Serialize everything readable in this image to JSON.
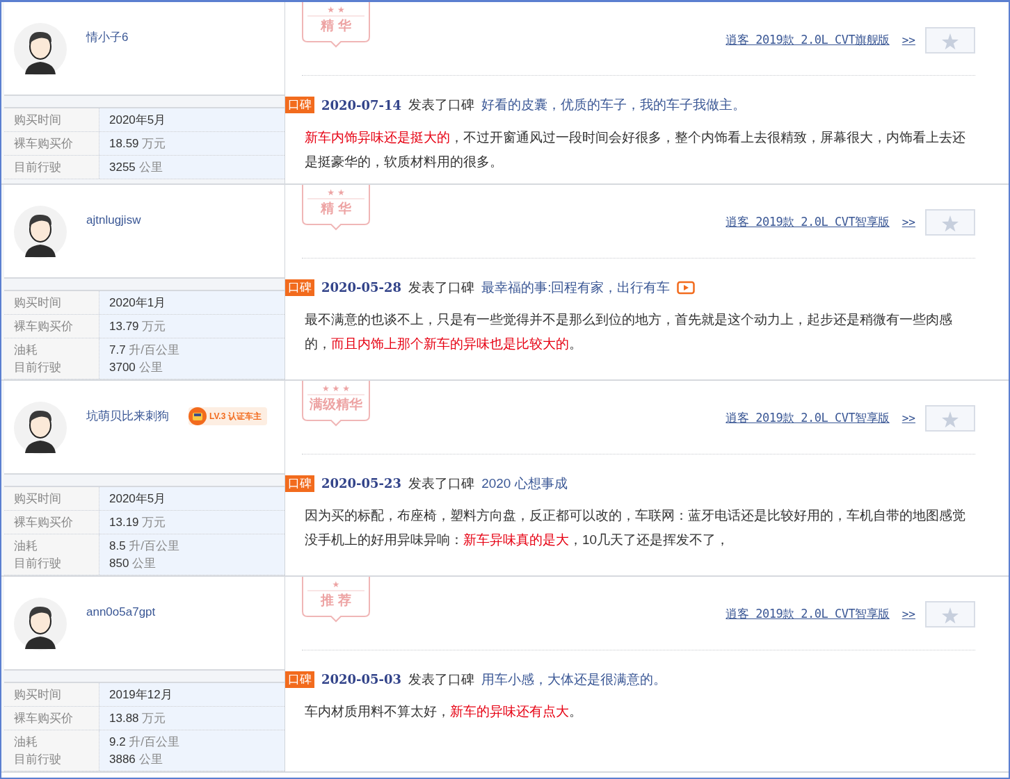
{
  "reviews": [
    {
      "user": {
        "name": "情小子6"
      },
      "specs": [
        {
          "labels": [
            "购买时间"
          ],
          "values": [
            {
              "num": "2020年5月"
            }
          ]
        },
        {
          "labels": [
            "裸车购买价"
          ],
          "values": [
            {
              "num": "18.59",
              "unit": "万元"
            }
          ]
        },
        {
          "labels": [
            "目前行驶"
          ],
          "values": [
            {
              "num": "3255",
              "unit": "公里"
            }
          ]
        }
      ],
      "stamp": {
        "ornament": "★ ★",
        "label": "精 华"
      },
      "model": "逍客 2019款 2.0L CVT旗舰版",
      "more": ">>",
      "tag": "口碑",
      "date": "2020-07-14",
      "action": "发表了口碑",
      "title": "好看的皮囊，优质的车子，我的车子我做主。",
      "video": false,
      "body": [
        {
          "text": "新车内饰异味还是挺大的",
          "highlight": true
        },
        {
          "text": "，不过开窗通风过一段时间会好很多，整个内饰看上去很精致，屏幕很大，内饰看上去还是挺豪华的，软质材料用的很多。",
          "highlight": false
        }
      ]
    },
    {
      "user": {
        "name": "ajtnlugjisw"
      },
      "specs": [
        {
          "labels": [
            "购买时间"
          ],
          "values": [
            {
              "num": "2020年1月"
            }
          ]
        },
        {
          "labels": [
            "裸车购买价"
          ],
          "values": [
            {
              "num": "13.79",
              "unit": "万元"
            }
          ]
        },
        {
          "labels": [
            "油耗",
            "目前行驶"
          ],
          "values": [
            {
              "num": "7.7",
              "unit": "升/百公里"
            },
            {
              "num": "3700",
              "unit": "公里"
            }
          ]
        }
      ],
      "stamp": {
        "ornament": "★ ★",
        "label": "精 华"
      },
      "model": "逍客 2019款 2.0L CVT智享版",
      "more": ">>",
      "tag": "口碑",
      "date": "2020-05-28",
      "action": "发表了口碑",
      "title": "最幸福的事:回程有家，出行有车",
      "video": true,
      "body": [
        {
          "text": "最不满意的也谈不上，只是有一些觉得并不是那么到位的地方，首先就是这个动力上，起步还是稍微有一些肉感的，",
          "highlight": false
        },
        {
          "text": "而且内饰上那个新车的异味也是比较大的",
          "highlight": true
        },
        {
          "text": "。",
          "highlight": false
        }
      ]
    },
    {
      "user": {
        "name": "坑萌贝比来刺狗",
        "certified": {
          "level": "LV.3",
          "label": "认证车主"
        }
      },
      "specs": [
        {
          "labels": [
            "购买时间"
          ],
          "values": [
            {
              "num": "2020年5月"
            }
          ]
        },
        {
          "labels": [
            "裸车购买价"
          ],
          "values": [
            {
              "num": "13.19",
              "unit": "万元"
            }
          ]
        },
        {
          "labels": [
            "油耗",
            "目前行驶"
          ],
          "values": [
            {
              "num": "8.5",
              "unit": "升/百公里"
            },
            {
              "num": "850",
              "unit": "公里"
            }
          ]
        }
      ],
      "stamp": {
        "ornament": "★ ★ ★",
        "label": "满级精华"
      },
      "model": "逍客 2019款 2.0L CVT智享版",
      "more": ">>",
      "tag": "口碑",
      "date": "2020-05-23",
      "action": "发表了口碑",
      "title": "2020 心想事成",
      "video": false,
      "body": [
        {
          "text": "因为买的标配，布座椅，塑料方向盘，反正都可以改的，车联网：蓝牙电话还是比较好用的，车机自带的地图感觉没手机上的好用异味异响：",
          "highlight": false
        },
        {
          "text": "新车异味真的是大",
          "highlight": true
        },
        {
          "text": "，10几天了还是挥发不了，",
          "highlight": false
        }
      ]
    },
    {
      "user": {
        "name": "ann0o5a7gpt"
      },
      "specs": [
        {
          "labels": [
            "购买时间"
          ],
          "values": [
            {
              "num": "2019年12月"
            }
          ]
        },
        {
          "labels": [
            "裸车购买价"
          ],
          "values": [
            {
              "num": "13.88",
              "unit": "万元"
            }
          ]
        },
        {
          "labels": [
            "油耗",
            "目前行驶"
          ],
          "values": [
            {
              "num": "9.2",
              "unit": "升/百公里"
            },
            {
              "num": "3886",
              "unit": "公里"
            }
          ]
        }
      ],
      "stamp": {
        "ornament": "★",
        "label": "推 荐"
      },
      "model": "逍客 2019款 2.0L CVT智享版",
      "more": ">>",
      "tag": "口碑",
      "date": "2020-05-03",
      "action": "发表了口碑",
      "title": "用车小感，大体还是很满意的。",
      "video": false,
      "body": [
        {
          "text": "车内材质用料不算太好，",
          "highlight": false
        },
        {
          "text": "新车的异味还有点大",
          "highlight": true
        },
        {
          "text": "。",
          "highlight": false
        }
      ]
    }
  ]
}
